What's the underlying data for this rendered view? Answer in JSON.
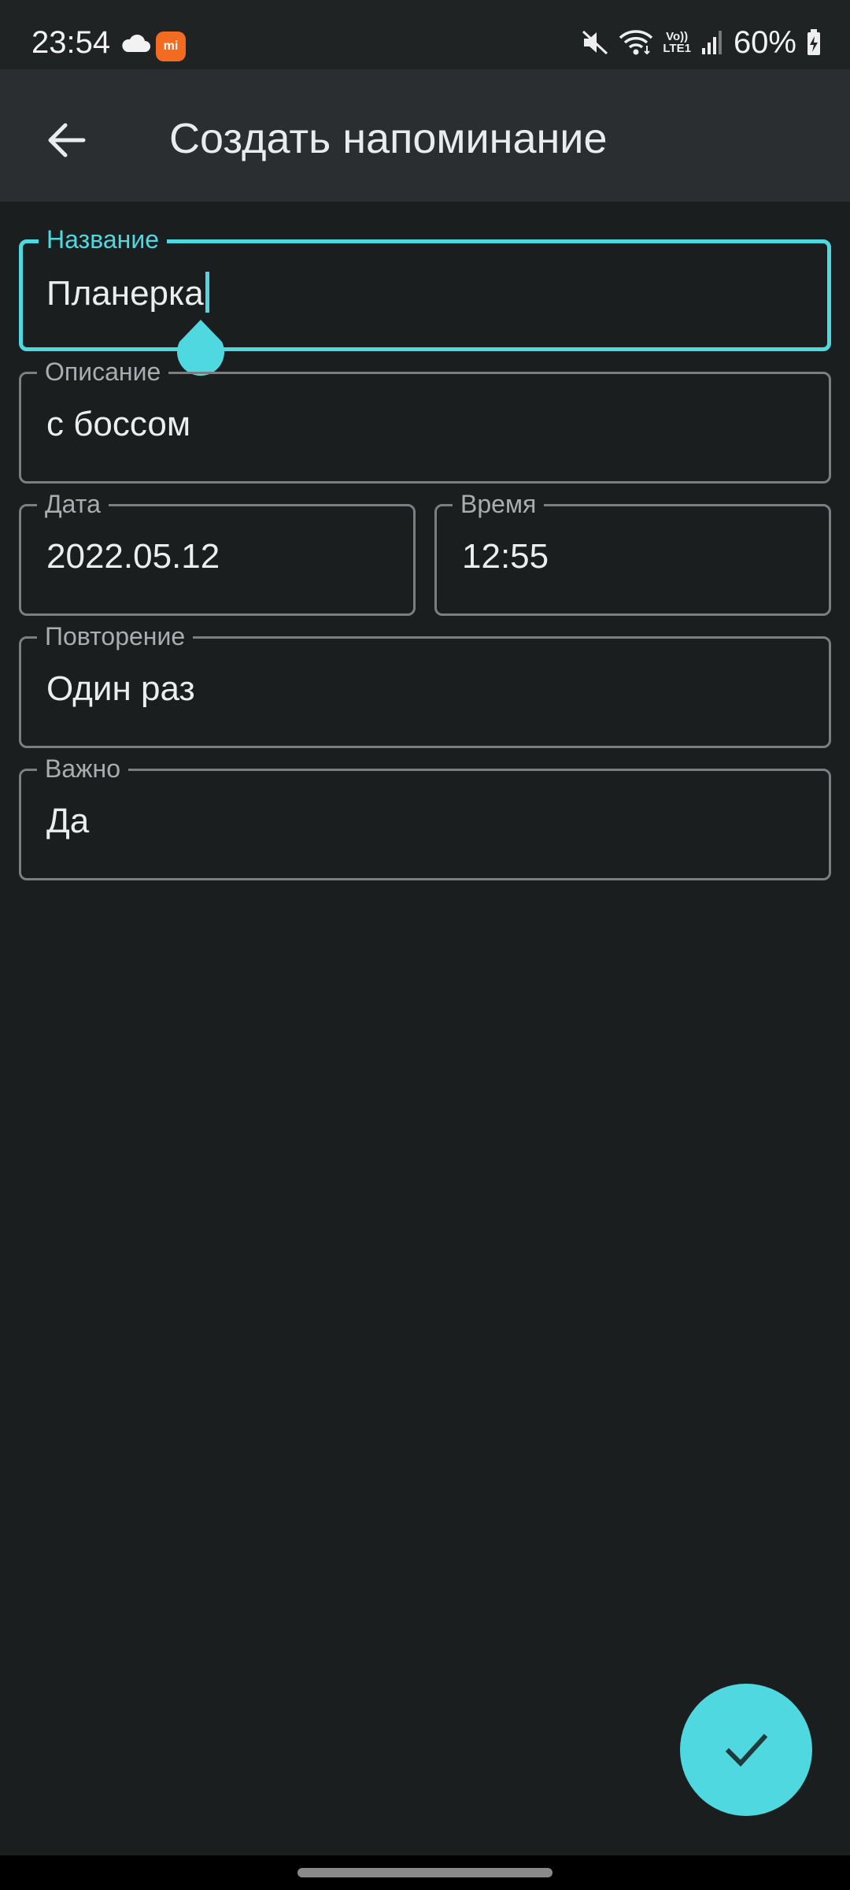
{
  "status_bar": {
    "time": "23:54",
    "battery_percent": "60%",
    "volte_top": "Vo))",
    "volte_bottom": "LTE1",
    "mi_label": "mi",
    "icons": [
      "cloud-icon",
      "mi-app-icon",
      "mute-icon",
      "wifi-icon",
      "volte-icon",
      "signal-icon",
      "battery-charging-icon"
    ]
  },
  "app_bar": {
    "title": "Создать напоминание",
    "back_icon": "arrow-back-icon"
  },
  "form": {
    "title_field": {
      "label": "Название",
      "value": "Планерка"
    },
    "description_field": {
      "label": "Описание",
      "value": "с боссом"
    },
    "date_field": {
      "label": "Дата",
      "value": "2022.05.12"
    },
    "time_field": {
      "label": "Время",
      "value": "12:55"
    },
    "repeat_field": {
      "label": "Повторение",
      "value": "Один раз"
    },
    "important_field": {
      "label": "Важно",
      "value": "Да"
    }
  },
  "fab": {
    "icon": "check-icon"
  },
  "colors": {
    "accent": "#4fd8df",
    "background": "#1b1e1f",
    "app_bar": "#2b2e30",
    "field_border": "#7b7f81"
  }
}
